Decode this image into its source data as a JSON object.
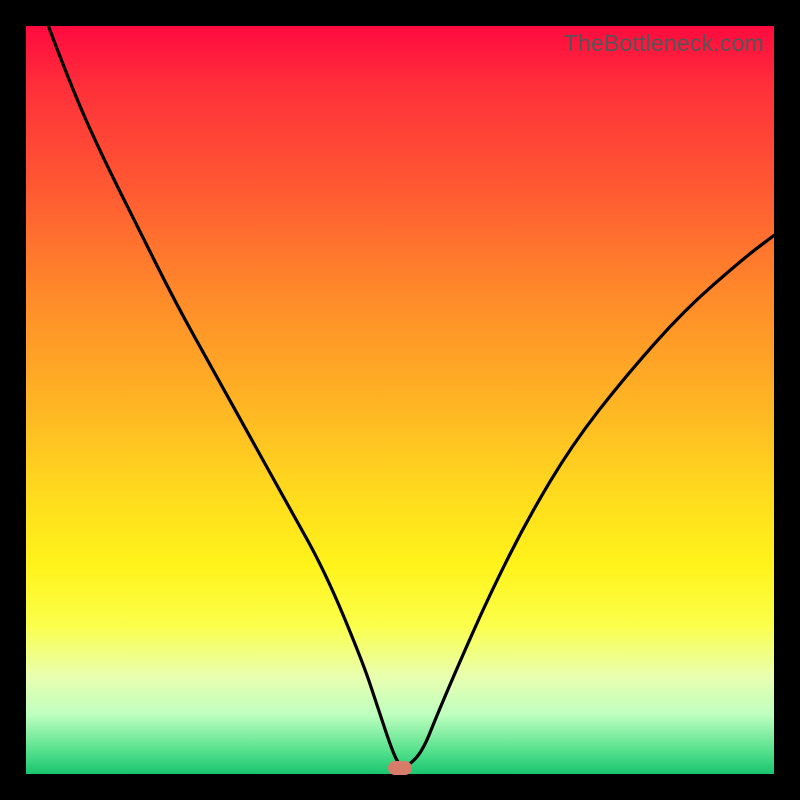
{
  "watermark": "TheBottleneck.com",
  "chart_data": {
    "type": "line",
    "title": "",
    "xlabel": "",
    "ylabel": "",
    "xlim": [
      0,
      100
    ],
    "ylim": [
      0,
      100
    ],
    "grid": false,
    "legend": false,
    "series": [
      {
        "name": "curve",
        "x": [
          3,
          6,
          10,
          15,
          20,
          25,
          30,
          35,
          40,
          45,
          47,
          49,
          50,
          51,
          53,
          55,
          58,
          62,
          67,
          73,
          80,
          88,
          96,
          100
        ],
        "y": [
          100,
          92,
          83,
          73,
          63,
          54,
          45,
          36,
          27,
          15,
          9,
          3,
          1,
          1,
          3,
          8,
          15,
          24,
          34,
          44,
          53,
          62,
          69,
          72
        ]
      }
    ],
    "marker": {
      "x": 50,
      "y": 0.8
    },
    "gradient_stops": [
      {
        "pos": 0,
        "color": "#ff0a3f"
      },
      {
        "pos": 50,
        "color": "#ffd91e"
      },
      {
        "pos": 100,
        "color": "#19c56f"
      }
    ]
  },
  "plot_geometry": {
    "inner_x": 26,
    "inner_y": 26,
    "inner_w": 748,
    "inner_h": 748
  }
}
